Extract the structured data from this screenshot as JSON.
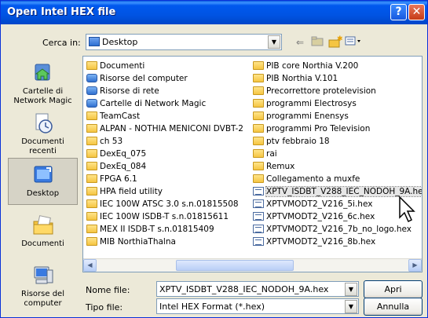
{
  "window": {
    "title": "Open Intel HEX file"
  },
  "titlebar": {
    "help_label": "?",
    "close_label": "✕"
  },
  "lookin": {
    "label": "Cerca in:",
    "value": "Desktop"
  },
  "toolbar": {
    "back_icon": "back-arrow-icon",
    "up_icon": "up-folder-icon",
    "new_folder_icon": "new-folder-icon",
    "view_icon": "view-menu-icon"
  },
  "places": [
    {
      "label": "Cartelle di Network Magic",
      "icon": "network-magic-folder-icon"
    },
    {
      "label": "Documenti recenti",
      "icon": "recent-documents-icon"
    },
    {
      "label": "Desktop",
      "icon": "desktop-icon"
    },
    {
      "label": "Documenti",
      "icon": "documents-icon"
    },
    {
      "label": "Risorse del computer",
      "icon": "computer-icon"
    }
  ],
  "files_col1": [
    {
      "name": "Documenti",
      "type": "folder"
    },
    {
      "name": "Risorse del computer",
      "type": "system"
    },
    {
      "name": "Risorse di rete",
      "type": "system"
    },
    {
      "name": "Cartelle di Network Magic",
      "type": "system"
    },
    {
      "name": "TeamCast",
      "type": "folder"
    },
    {
      "name": "ALPAN - NOTHIA MENICONI DVBT-2",
      "type": "folder"
    },
    {
      "name": "ch 53",
      "type": "folder"
    },
    {
      "name": "DexEq_075",
      "type": "folder"
    },
    {
      "name": "DexEq_084",
      "type": "folder"
    },
    {
      "name": "FPGA 6.1",
      "type": "folder"
    },
    {
      "name": "HPA field utility",
      "type": "folder"
    },
    {
      "name": "IEC 100W ATSC 3.0 s.n.01815508",
      "type": "folder"
    },
    {
      "name": "IEC 100W ISDB-T s.n.01815611",
      "type": "folder"
    },
    {
      "name": "MEX II ISDB-T s.n.01815409",
      "type": "folder"
    },
    {
      "name": "MIB NorthiaThalna",
      "type": "folder"
    }
  ],
  "files_col2": [
    {
      "name": "PIB core Northia  V.200",
      "type": "folder"
    },
    {
      "name": "PIB Northia V.101",
      "type": "folder"
    },
    {
      "name": "Precorrettore protelevision",
      "type": "folder"
    },
    {
      "name": "programmi Electrosys",
      "type": "folder"
    },
    {
      "name": "programmi Enensys",
      "type": "folder"
    },
    {
      "name": "programmi Pro Television",
      "type": "folder"
    },
    {
      "name": "ptv febbraio 18",
      "type": "folder"
    },
    {
      "name": "rai",
      "type": "folder"
    },
    {
      "name": "Remux",
      "type": "folder"
    },
    {
      "name": "Collegamento a muxfe",
      "type": "shortcut"
    },
    {
      "name": "XPTV_ISDBT_V288_IEC_NODOH_9A.hex",
      "type": "hex",
      "selected": true
    },
    {
      "name": "XPTVMODT2_V216_5i.hex",
      "type": "hex"
    },
    {
      "name": "XPTVMODT2_V216_6c.hex",
      "type": "hex"
    },
    {
      "name": "XPTVMODT2_V216_7b_no_logo.hex",
      "type": "hex"
    },
    {
      "name": "XPTVMODT2_V216_8b.hex",
      "type": "hex"
    }
  ],
  "filename": {
    "label": "Nome file:",
    "value": "XPTV_ISDBT_V288_IEC_NODOH_9A.hex"
  },
  "filetype": {
    "label": "Tipo file:",
    "value": "Intel HEX Format (*.hex)"
  },
  "buttons": {
    "open": "Apri",
    "cancel": "Annulla"
  }
}
